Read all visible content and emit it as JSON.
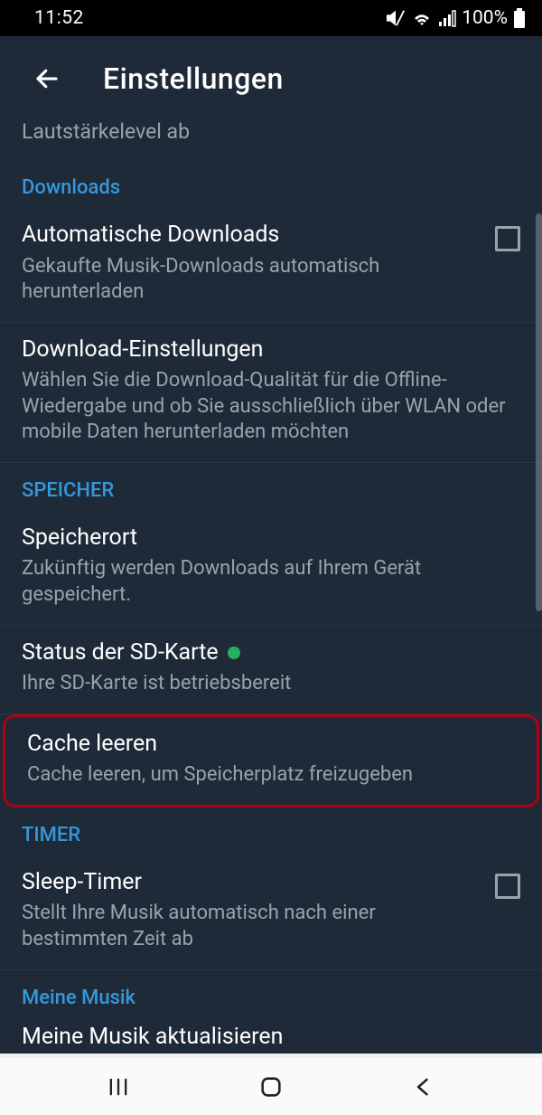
{
  "status": {
    "time": "11:52",
    "battery_pct": "100%"
  },
  "header": {
    "title": "Einstellungen"
  },
  "truncated_prev": "Lautstärkelevel ab",
  "sections": {
    "downloads": {
      "label": "Downloads",
      "auto_dl": {
        "title": "Automatische Downloads",
        "sub": "Gekaufte Musik-Downloads automatisch herunterladen"
      },
      "dl_settings": {
        "title": "Download-Einstellungen",
        "sub": "Wählen Sie die Download-Qualität für die Offline-Wiedergabe und ob Sie ausschließlich über WLAN oder mobile Daten herunterladen möchten"
      }
    },
    "storage": {
      "label": "SPEICHER",
      "location": {
        "title": "Speicherort",
        "sub": "Zukünftig werden Downloads auf Ihrem Gerät gespeichert."
      },
      "sd_status": {
        "title": "Status der SD-Karte",
        "sub": "Ihre SD-Karte ist betriebsbereit"
      },
      "clear_cache": {
        "title": "Cache leeren",
        "sub": "Cache leeren, um Speicherplatz freizugeben"
      }
    },
    "timer": {
      "label": "TIMER",
      "sleep": {
        "title": "Sleep-Timer",
        "sub": "Stellt Ihre Musik automatisch nach einer bestimmten Zeit ab"
      }
    },
    "mymusic": {
      "label": "Meine Musik",
      "refresh": {
        "title": "Meine Musik aktualisieren"
      }
    }
  }
}
